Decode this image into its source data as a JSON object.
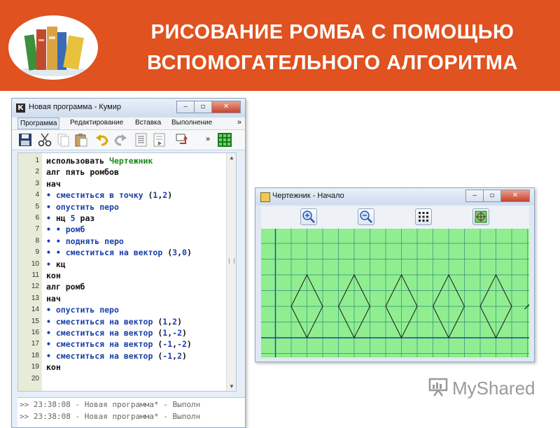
{
  "slide": {
    "title_line1": "РИСОВАНИЕ РОМБА С ПОМОЩЬЮ",
    "title_line2": "ВСПОМОГАТЕЛЬНОГО АЛГОРИТМА",
    "banner_color": "#e0521f"
  },
  "editor": {
    "app_icon": "К",
    "window_title": "Новая программа - Кумир",
    "window_buttons": [
      "minimize-icon",
      "maximize-icon",
      "close-icon"
    ],
    "menu": [
      "Программа",
      "Редактирование",
      "Вставка",
      "Выполнение"
    ],
    "menu_more": "»",
    "toolbar_icons": [
      "save-icon",
      "cut-icon",
      "copy-icon",
      "paste-icon",
      "undo-icon",
      "redo-icon",
      "indent-icon",
      "unindent-icon",
      "insert-icon",
      "grid-icon"
    ],
    "toolbar_more": "»",
    "code_lines": [
      {
        "n": "1",
        "text": "использовать Чертежник"
      },
      {
        "n": "2",
        "text": "алг пять ромбов"
      },
      {
        "n": "3",
        "text": "нач"
      },
      {
        "n": "4",
        "text": "• сместиться в точку (1,2)"
      },
      {
        "n": "5",
        "text": "• опустить перо"
      },
      {
        "n": "6",
        "text": "• нц 5 раз"
      },
      {
        "n": "7",
        "text": "• • ромб"
      },
      {
        "n": "8",
        "text": "• • поднять перо"
      },
      {
        "n": "9",
        "text": "• • сместиться на вектор (3,0)"
      },
      {
        "n": "10",
        "text": "• кц"
      },
      {
        "n": "11",
        "text": "кон"
      },
      {
        "n": "12",
        "text": "алг ромб"
      },
      {
        "n": "13",
        "text": "нач"
      },
      {
        "n": "14",
        "text": "• опустить перо"
      },
      {
        "n": "15",
        "text": "• сместиться на вектор (1,2)"
      },
      {
        "n": "16",
        "text": "• сместиться на вектор (1,-2)"
      },
      {
        "n": "17",
        "text": "• сместиться на вектор (-1,-2)"
      },
      {
        "n": "18",
        "text": "• сместиться на вектор (-1,2)"
      },
      {
        "n": "19",
        "text": "кон"
      },
      {
        "n": "20",
        "text": ""
      }
    ],
    "log": [
      ">> 23:38:08 - Новая программа* - Выполн",
      ">> 23:38:08 - Новая программа* - Выполн"
    ]
  },
  "drawer": {
    "window_title": "Чертежник - Начало",
    "toolbar_icons": [
      "zoom-in-icon",
      "zoom-out-icon",
      "grid-icon",
      "fit-icon"
    ],
    "canvas_color": "#90ee90",
    "rhombus_count": 5,
    "rhombus_start": [
      1,
      2
    ],
    "rhombus_step": [
      3,
      0
    ],
    "rhombus_vectors": [
      [
        1,
        2
      ],
      [
        1,
        -2
      ],
      [
        -1,
        -2
      ],
      [
        -1,
        2
      ]
    ]
  },
  "watermark": {
    "text": "MyShared"
  }
}
